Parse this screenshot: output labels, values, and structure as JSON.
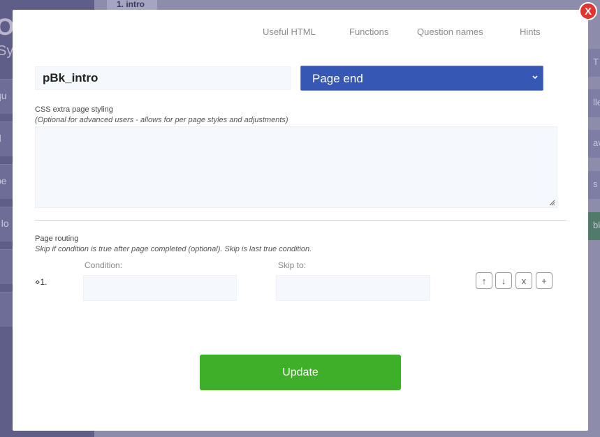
{
  "background": {
    "tab": "1. intro",
    "logo": "O",
    "logo_sub": "Sy",
    "left_buttons": [
      "qu",
      "d",
      "pe",
      "t lo",
      "",
      ""
    ],
    "right_buttons": [
      "T",
      "lle",
      "ave",
      "s a",
      "bl"
    ]
  },
  "modal": {
    "close_label": "X",
    "top_links": [
      "Useful HTML",
      "Functions",
      "Question names",
      "Hints"
    ],
    "page_name": "pBk_intro",
    "page_type": {
      "selected": "Page end"
    },
    "css": {
      "label": "CSS extra page styling",
      "hint": "(Optional for advanced users - allows for per page styles and adjustments)",
      "value": ""
    },
    "routing": {
      "label": "Page routing",
      "hint": "Skip if condition is true after page completed (optional). Skip is last true condition.",
      "condition_header": "Condition:",
      "skip_header": "Skip to:",
      "rows": [
        {
          "num": "⋄1.",
          "condition": "",
          "skip_to": ""
        }
      ],
      "row_buttons": [
        "↑",
        "↓",
        "x",
        "+"
      ]
    },
    "update_label": "Update"
  },
  "colors": {
    "page_type_bg": "#3657b4",
    "update_bg": "#3fae29",
    "close_bg": "#e2332f"
  }
}
